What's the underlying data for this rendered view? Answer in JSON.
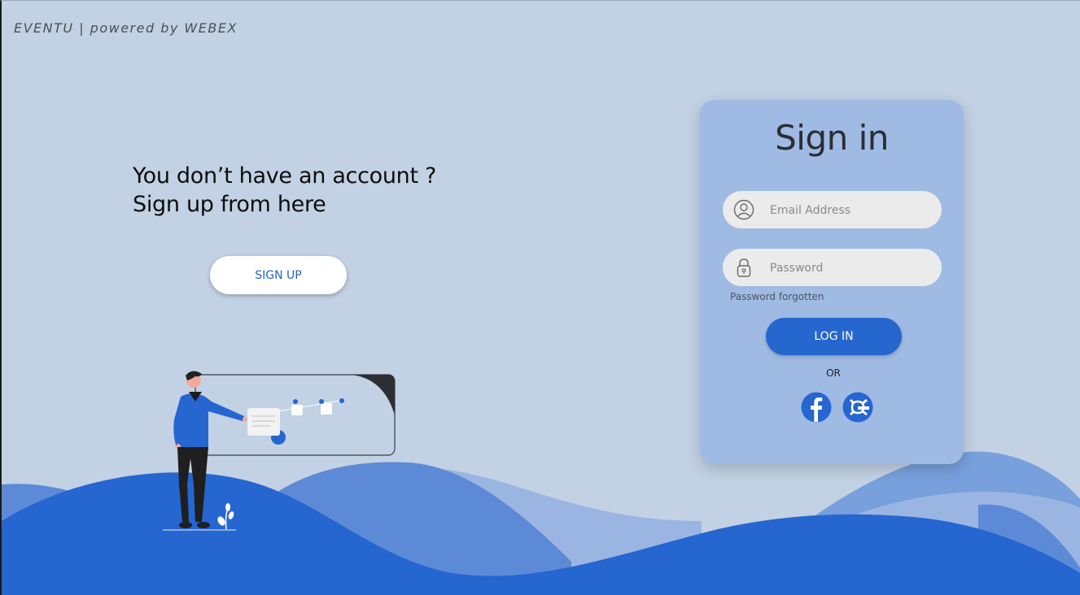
{
  "header": {
    "brand": "EVENTU | powered by WEBEX"
  },
  "promo": {
    "line1": "You don’t have an account ?",
    "line2": "Sign up from here",
    "signup_label": "SIGN UP"
  },
  "signin": {
    "title": "Sign in",
    "email_placeholder": "Email Address",
    "email_icon": "user-icon",
    "password_placeholder": "Password",
    "password_icon": "lock-icon",
    "forgot_label": "Password forgotten",
    "login_label": "LOG IN",
    "or_label": "OR",
    "social": [
      {
        "icon": "facebook-icon"
      },
      {
        "icon": "google-icon"
      }
    ]
  },
  "colors": {
    "background": "#c2d1e4",
    "card": "#9fbae3",
    "accent": "#2666cf",
    "hill_dark": "#2566d0",
    "hill_mid": "#5d8ad6",
    "hill_light": "#9bb5e2"
  }
}
